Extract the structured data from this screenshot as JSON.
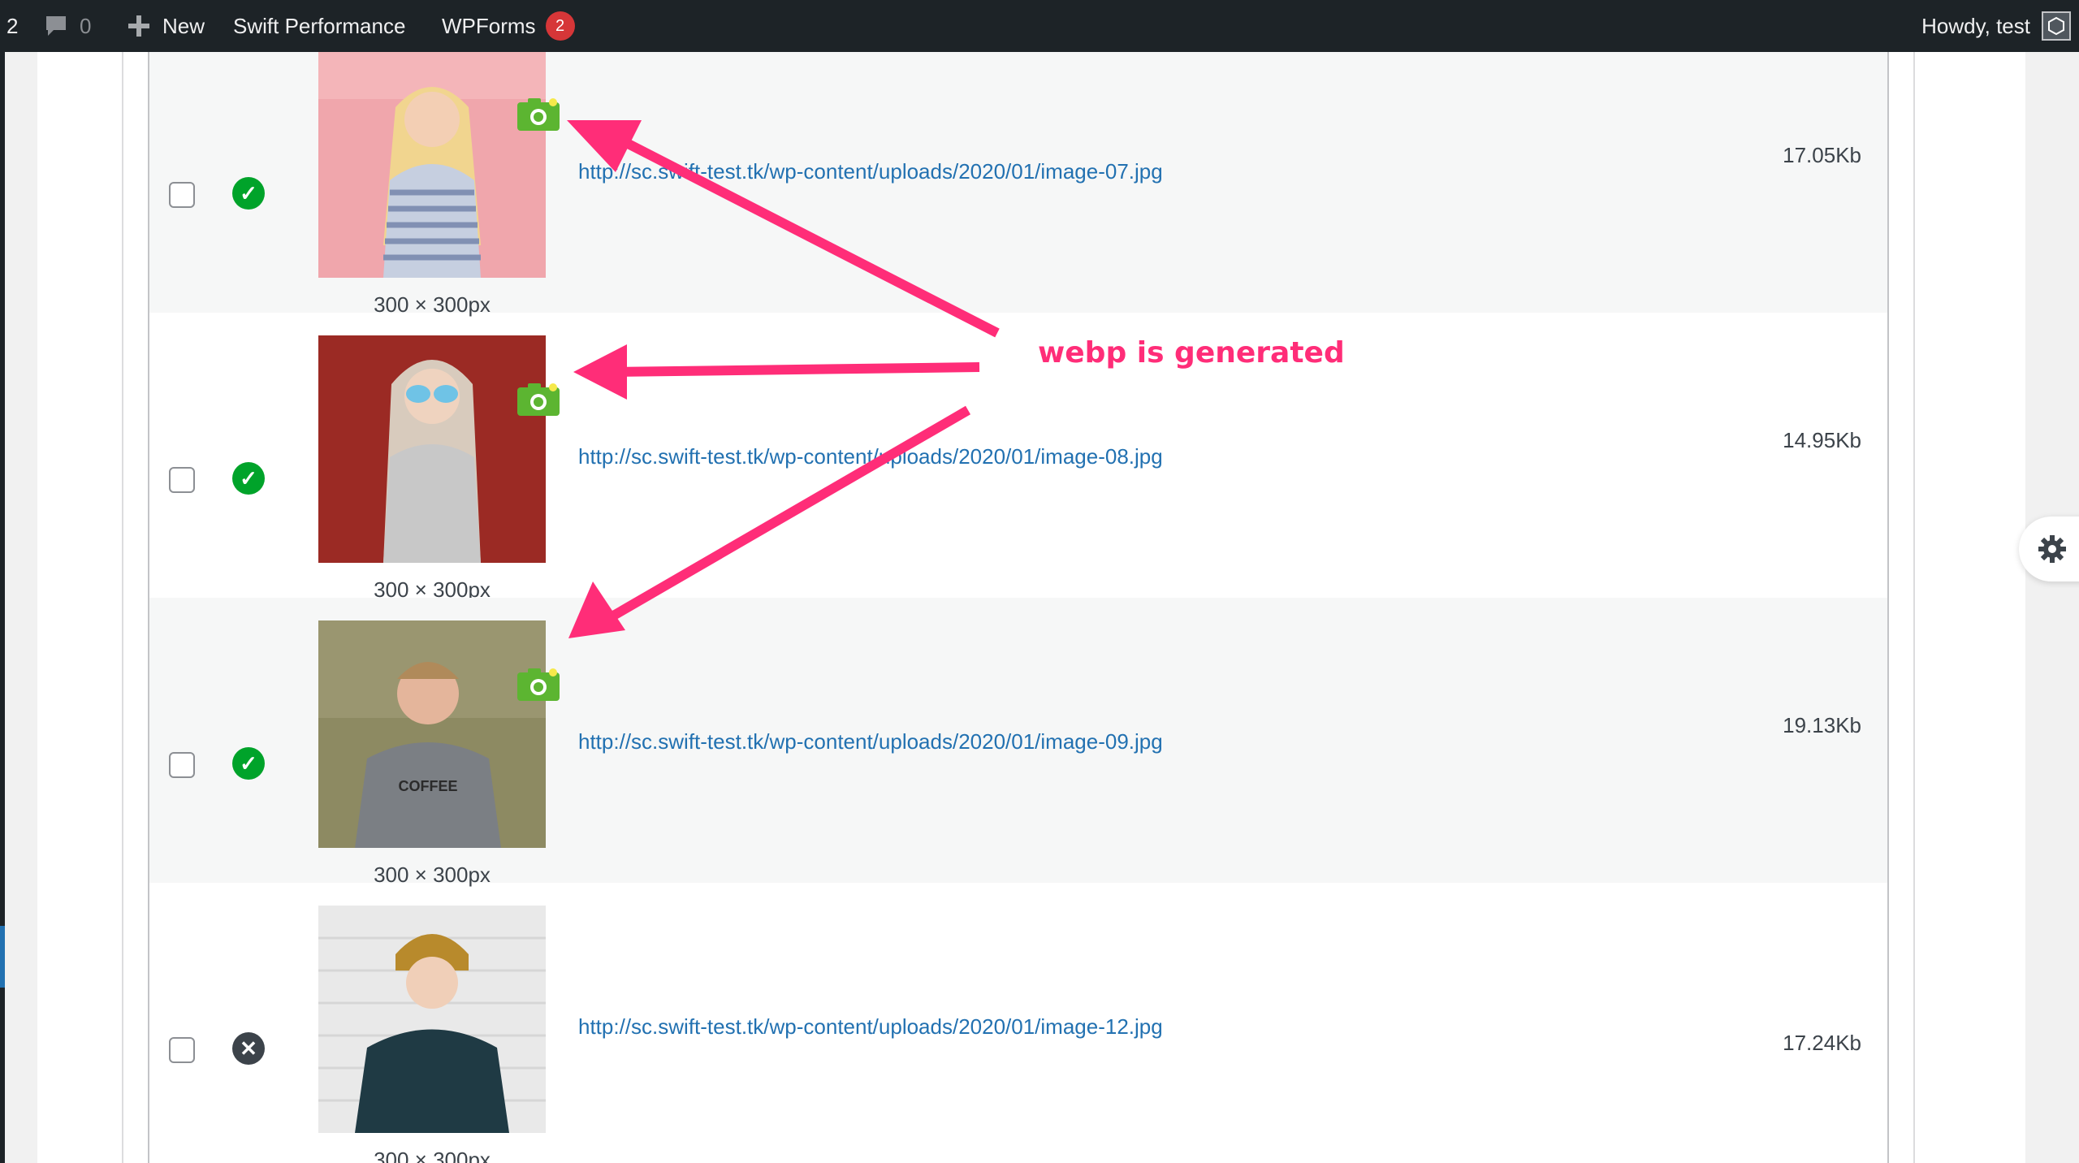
{
  "adminbar": {
    "updates_count": "2",
    "comments_count": "0",
    "new_label": "New",
    "swift_label": "Swift Performance",
    "wpforms_label": "WPForms",
    "wpforms_badge": "2",
    "howdy": "Howdy, test"
  },
  "annotation": {
    "label": "webp is generated",
    "color": "#ff2d78"
  },
  "rows": [
    {
      "status": "generated",
      "dimensions": "300 × 300px",
      "url": "http://sc.swift-test.tk/wp-content/uploads/2020/01/image-07.jpg",
      "size": "17.05Kb",
      "webp_icon": "camera-icon"
    },
    {
      "status": "generated",
      "dimensions": "300 × 300px",
      "url": "http://sc.swift-test.tk/wp-content/uploads/2020/01/image-08.jpg",
      "size": "14.95Kb",
      "webp_icon": "camera-icon"
    },
    {
      "status": "generated",
      "dimensions": "300 × 300px",
      "url": "http://sc.swift-test.tk/wp-content/uploads/2020/01/image-09.jpg",
      "size": "19.13Kb",
      "webp_icon": "camera-icon"
    },
    {
      "status": "failed",
      "dimensions": "300 × 300px",
      "url": "http://sc.swift-test.tk/wp-content/uploads/2020/01/image-12.jpg",
      "size": "17.24Kb"
    }
  ],
  "colors": {
    "success": "#00a32a",
    "link": "#2271b1",
    "adminbar": "#1d2327",
    "badge": "#d63638"
  }
}
